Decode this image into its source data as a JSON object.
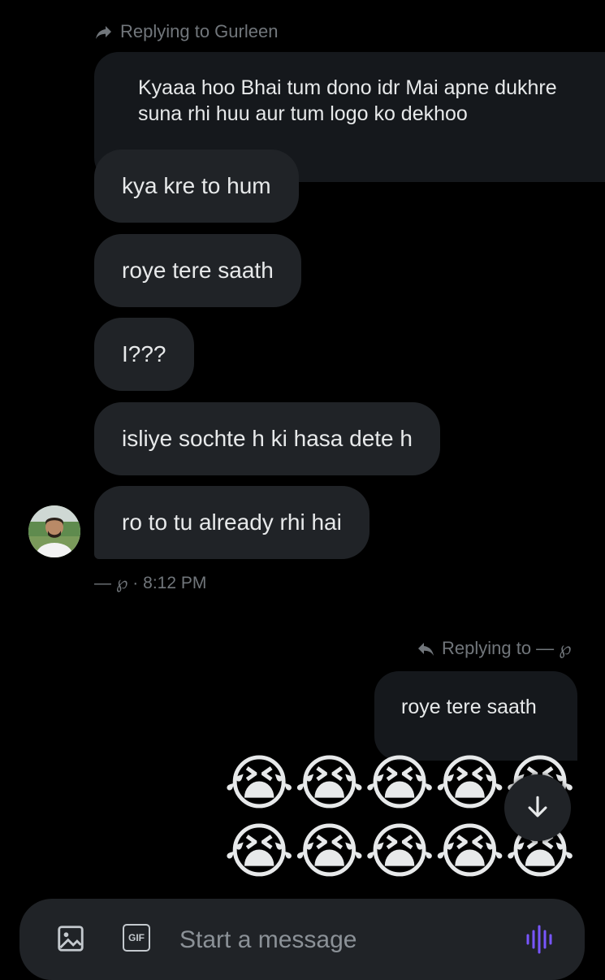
{
  "thread": {
    "reply_to_top": "Replying to Gurleen",
    "quoted_top": "Kyaaa hoo Bhai tum dono idr Mai apne dukhre suna rhi huu aur tum logo ko dekhoo",
    "messages": [
      {
        "text": "kya kre to hum"
      },
      {
        "text": "roye tere saath"
      },
      {
        "text": "I???"
      },
      {
        "text": "isliye sochte h ki hasa dete h"
      },
      {
        "text": "ro to tu already rhi hai"
      }
    ],
    "timestamp": "— ℘ · 8:12 PM",
    "reply_to_right": "Replying to — ℘",
    "quoted_right": "roye tere saath",
    "emoji_row_1": "😭😭😭😭😭",
    "emoji_row_2": "😭😭😭😭😭"
  },
  "composer": {
    "placeholder": "Start a message",
    "gif_label": "GIF"
  },
  "colors": {
    "background": "#000000",
    "bubble": "#202327",
    "quoted": "#15181c",
    "muted_text": "#71767b",
    "accent": "#7856ff"
  },
  "icons": {
    "reply_top": "reply-arrow-icon",
    "reply_right": "reply-arrow-icon",
    "media": "image-icon",
    "gif": "gif-icon",
    "voice": "voice-icon",
    "scroll": "arrow-down-icon"
  }
}
